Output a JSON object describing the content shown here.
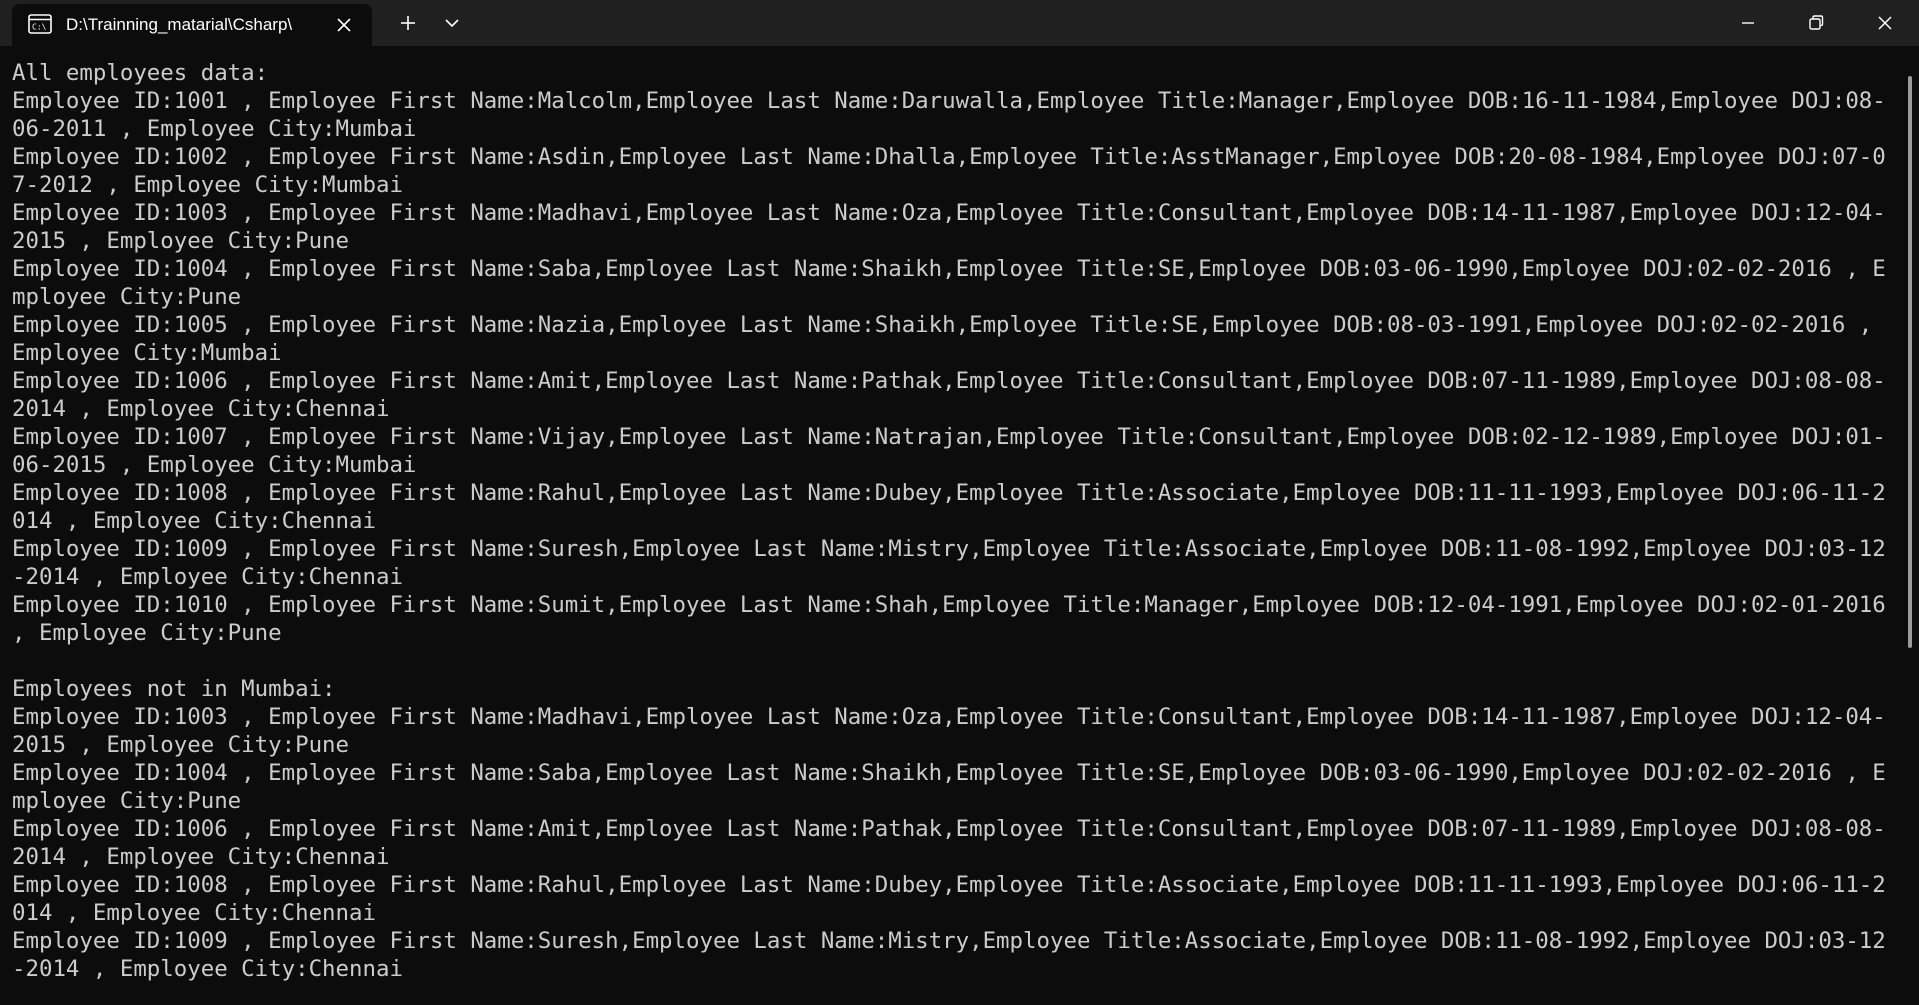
{
  "window": {
    "tab_title": "D:\\Trainning_matarial\\Csharp\\",
    "tab_icon": "terminal-icon",
    "new_tab_icon": "plus-icon",
    "dropdown_icon": "chevron-down-icon",
    "minimize_icon": "minimize-icon",
    "maximize_icon": "restore-icon",
    "close_icon": "close-icon"
  },
  "colors": {
    "background": "#0c0c0c",
    "titlebar": "#202020",
    "text": "#cccccc"
  },
  "console": {
    "lines": [
      "All employees data:",
      "Employee ID:1001 , Employee First Name:Malcolm,Employee Last Name:Daruwalla,Employee Title:Manager,Employee DOB:16-11-1984,Employee DOJ:08-06-2011 , Employee City:Mumbai",
      "Employee ID:1002 , Employee First Name:Asdin,Employee Last Name:Dhalla,Employee Title:AsstManager,Employee DOB:20-08-1984,Employee DOJ:07-07-2012 , Employee City:Mumbai",
      "Employee ID:1003 , Employee First Name:Madhavi,Employee Last Name:Oza,Employee Title:Consultant,Employee DOB:14-11-1987,Employee DOJ:12-04-2015 , Employee City:Pune",
      "Employee ID:1004 , Employee First Name:Saba,Employee Last Name:Shaikh,Employee Title:SE,Employee DOB:03-06-1990,Employee DOJ:02-02-2016 , Employee City:Pune",
      "Employee ID:1005 , Employee First Name:Nazia,Employee Last Name:Shaikh,Employee Title:SE,Employee DOB:08-03-1991,Employee DOJ:02-02-2016 , Employee City:Mumbai",
      "Employee ID:1006 , Employee First Name:Amit,Employee Last Name:Pathak,Employee Title:Consultant,Employee DOB:07-11-1989,Employee DOJ:08-08-2014 , Employee City:Chennai",
      "Employee ID:1007 , Employee First Name:Vijay,Employee Last Name:Natrajan,Employee Title:Consultant,Employee DOB:02-12-1989,Employee DOJ:01-06-2015 , Employee City:Mumbai",
      "Employee ID:1008 , Employee First Name:Rahul,Employee Last Name:Dubey,Employee Title:Associate,Employee DOB:11-11-1993,Employee DOJ:06-11-2014 , Employee City:Chennai",
      "Employee ID:1009 , Employee First Name:Suresh,Employee Last Name:Mistry,Employee Title:Associate,Employee DOB:11-08-1992,Employee DOJ:03-12-2014 , Employee City:Chennai",
      "Employee ID:1010 , Employee First Name:Sumit,Employee Last Name:Shah,Employee Title:Manager,Employee DOB:12-04-1991,Employee DOJ:02-01-2016 , Employee City:Pune",
      "",
      "Employees not in Mumbai:",
      "Employee ID:1003 , Employee First Name:Madhavi,Employee Last Name:Oza,Employee Title:Consultant,Employee DOB:14-11-1987,Employee DOJ:12-04-2015 , Employee City:Pune",
      "Employee ID:1004 , Employee First Name:Saba,Employee Last Name:Shaikh,Employee Title:SE,Employee DOB:03-06-1990,Employee DOJ:02-02-2016 , Employee City:Pune",
      "Employee ID:1006 , Employee First Name:Amit,Employee Last Name:Pathak,Employee Title:Consultant,Employee DOB:07-11-1989,Employee DOJ:08-08-2014 , Employee City:Chennai",
      "Employee ID:1008 , Employee First Name:Rahul,Employee Last Name:Dubey,Employee Title:Associate,Employee DOB:11-11-1993,Employee DOJ:06-11-2014 , Employee City:Chennai",
      "Employee ID:1009 , Employee First Name:Suresh,Employee Last Name:Mistry,Employee Title:Associate,Employee DOB:11-08-1992,Employee DOJ:03-12-2014 , Employee City:Chennai"
    ]
  }
}
